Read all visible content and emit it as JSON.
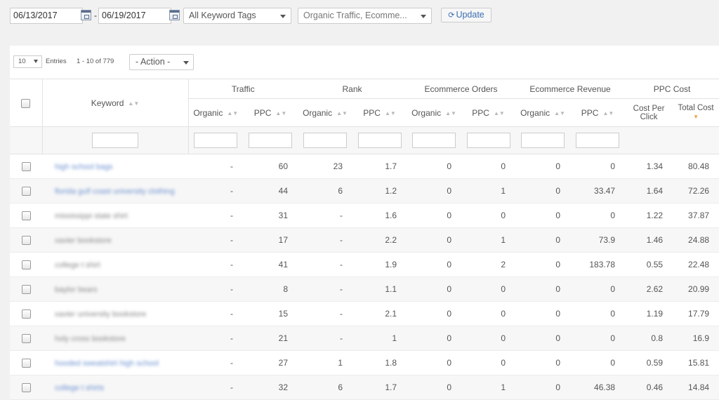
{
  "toolbar": {
    "start_date": "06/13/2017",
    "end_date": "06/19/2017",
    "date_separator": "-",
    "keyword_tags": "All Keyword Tags",
    "metrics": "Organic Traffic, Ecomme...",
    "update_label": "Update",
    "update_icon": "⟳"
  },
  "pagination": {
    "per_page": "10",
    "entries_label": "Entries",
    "range": "1 - 10 of 779",
    "action": "- Action -"
  },
  "header": {
    "keyword": "Keyword",
    "groups": {
      "traffic": "Traffic",
      "rank": "Rank",
      "ecommerce_orders": "Ecommerce Orders",
      "ecommerce_revenue": "Ecommerce Revenue",
      "ppc_cost": "PPC Cost"
    },
    "organic": "Organic",
    "ppc": "PPC",
    "cost_per_click": "Cost Per Click",
    "total_cost": "Total Cost",
    "sort_icon": "▲▼",
    "sort_active_icon": "▼"
  },
  "rows": [
    {
      "keyword": "high school bags",
      "link": true,
      "traffic_organic": "-",
      "traffic_ppc": "60",
      "rank_organic": "23",
      "rank_ppc": "1.7",
      "orders_organic": "0",
      "orders_ppc": "0",
      "revenue_organic": "0",
      "revenue_ppc": "0",
      "cpc": "1.34",
      "total_cost": "80.48"
    },
    {
      "keyword": "florida gulf coast university clothing",
      "link": true,
      "traffic_organic": "-",
      "traffic_ppc": "44",
      "rank_organic": "6",
      "rank_ppc": "1.2",
      "orders_organic": "0",
      "orders_ppc": "1",
      "revenue_organic": "0",
      "revenue_ppc": "33.47",
      "cpc": "1.64",
      "total_cost": "72.26"
    },
    {
      "keyword": "mississippi state shirt",
      "link": false,
      "traffic_organic": "-",
      "traffic_ppc": "31",
      "rank_organic": "-",
      "rank_ppc": "1.6",
      "orders_organic": "0",
      "orders_ppc": "0",
      "revenue_organic": "0",
      "revenue_ppc": "0",
      "cpc": "1.22",
      "total_cost": "37.87"
    },
    {
      "keyword": "xavier bookstore",
      "link": false,
      "traffic_organic": "-",
      "traffic_ppc": "17",
      "rank_organic": "-",
      "rank_ppc": "2.2",
      "orders_organic": "0",
      "orders_ppc": "1",
      "revenue_organic": "0",
      "revenue_ppc": "73.9",
      "cpc": "1.46",
      "total_cost": "24.88"
    },
    {
      "keyword": "college t shirt",
      "link": false,
      "traffic_organic": "-",
      "traffic_ppc": "41",
      "rank_organic": "-",
      "rank_ppc": "1.9",
      "orders_organic": "0",
      "orders_ppc": "2",
      "revenue_organic": "0",
      "revenue_ppc": "183.78",
      "cpc": "0.55",
      "total_cost": "22.48"
    },
    {
      "keyword": "baylor bears",
      "link": false,
      "traffic_organic": "-",
      "traffic_ppc": "8",
      "rank_organic": "-",
      "rank_ppc": "1.1",
      "orders_organic": "0",
      "orders_ppc": "0",
      "revenue_organic": "0",
      "revenue_ppc": "0",
      "cpc": "2.62",
      "total_cost": "20.99"
    },
    {
      "keyword": "xavier university bookstore",
      "link": false,
      "traffic_organic": "-",
      "traffic_ppc": "15",
      "rank_organic": "-",
      "rank_ppc": "2.1",
      "orders_organic": "0",
      "orders_ppc": "0",
      "revenue_organic": "0",
      "revenue_ppc": "0",
      "cpc": "1.19",
      "total_cost": "17.79"
    },
    {
      "keyword": "holy cross bookstore",
      "link": false,
      "traffic_organic": "-",
      "traffic_ppc": "21",
      "rank_organic": "-",
      "rank_ppc": "1",
      "orders_organic": "0",
      "orders_ppc": "0",
      "revenue_organic": "0",
      "revenue_ppc": "0",
      "cpc": "0.8",
      "total_cost": "16.9"
    },
    {
      "keyword": "hooded sweatshirt high school",
      "link": true,
      "traffic_organic": "-",
      "traffic_ppc": "27",
      "rank_organic": "1",
      "rank_ppc": "1.8",
      "orders_organic": "0",
      "orders_ppc": "0",
      "revenue_organic": "0",
      "revenue_ppc": "0",
      "cpc": "0.59",
      "total_cost": "15.81"
    },
    {
      "keyword": "college t shirts",
      "link": true,
      "traffic_organic": "-",
      "traffic_ppc": "32",
      "rank_organic": "6",
      "rank_ppc": "1.7",
      "orders_organic": "0",
      "orders_ppc": "1",
      "revenue_organic": "0",
      "revenue_ppc": "46.38",
      "cpc": "0.46",
      "total_cost": "14.84"
    }
  ],
  "colors": {
    "link": "#6a8fd0",
    "sort_active": "#e8a33d",
    "update_text": "#3a6fb0"
  }
}
